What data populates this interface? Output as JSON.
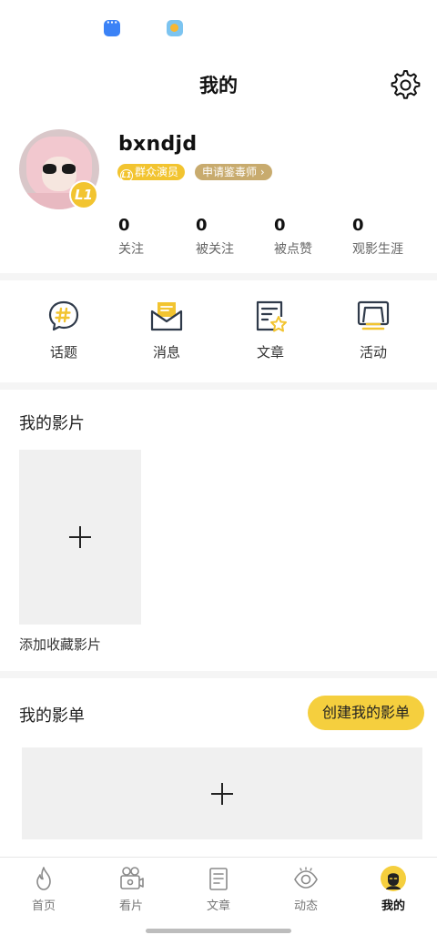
{
  "status_bar": {
    "icons": [
      "message-app-icon",
      "weather-app-icon"
    ]
  },
  "header": {
    "title": "我的",
    "settings_icon": "gear-icon"
  },
  "profile": {
    "username": "bxndjd",
    "level_badge": "L1",
    "level_tag_prefix": "L1",
    "level_tag": "群众演员",
    "apply_tag": "申请鉴毒师 ›",
    "stats": [
      {
        "value": "0",
        "label": "关注"
      },
      {
        "value": "0",
        "label": "被关注"
      },
      {
        "value": "0",
        "label": "被点赞"
      },
      {
        "value": "0",
        "label": "观影生涯"
      }
    ]
  },
  "quick_actions": [
    {
      "label": "话题",
      "icon": "hashtag-bubble-icon"
    },
    {
      "label": "消息",
      "icon": "envelope-icon"
    },
    {
      "label": "文章",
      "icon": "document-star-icon"
    },
    {
      "label": "活动",
      "icon": "event-icon"
    }
  ],
  "my_films": {
    "title": "我的影片",
    "add_caption": "添加收藏影片"
  },
  "my_lists": {
    "title": "我的影单",
    "create_button": "创建我的影单"
  },
  "tabbar": [
    {
      "label": "首页",
      "icon": "flame-icon",
      "active": false
    },
    {
      "label": "看片",
      "icon": "film-camera-icon",
      "active": false
    },
    {
      "label": "文章",
      "icon": "document-icon",
      "active": false
    },
    {
      "label": "动态",
      "icon": "eye-icon",
      "active": false
    },
    {
      "label": "我的",
      "icon": "profile-face-icon",
      "active": true
    }
  ],
  "colors": {
    "accent": "#f5cf3e",
    "badge": "#f2c430",
    "apply_tag": "#c8ab6e",
    "divider": "#f5f5f5",
    "tile": "#f0f0f0"
  }
}
